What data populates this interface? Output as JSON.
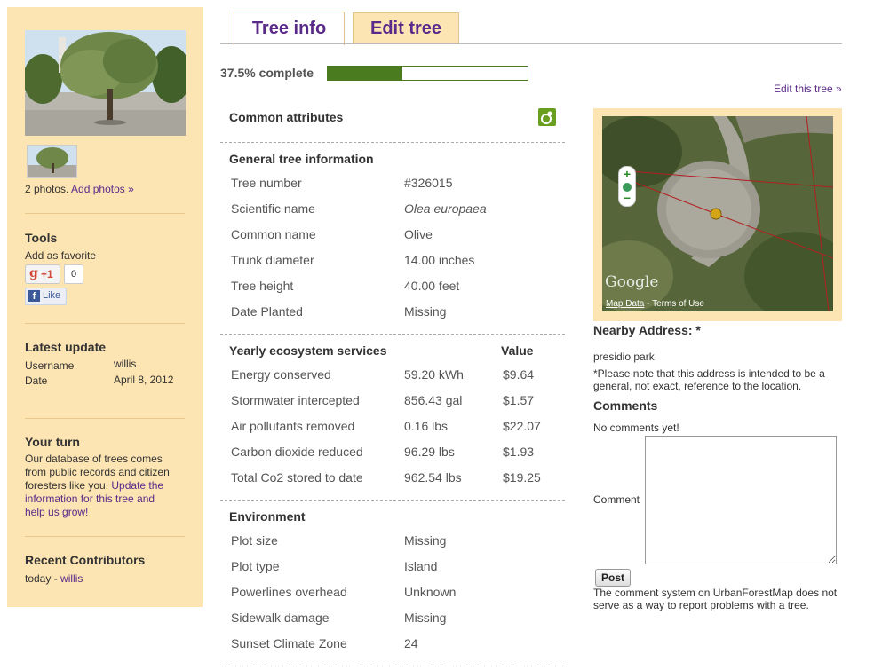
{
  "sidebar": {
    "photos_count": "2 photos.",
    "add_photos": "Add photos »",
    "tools_heading": "Tools",
    "add_favorite": "Add as favorite",
    "gplus_label": "+1",
    "gplus_count": "0",
    "fb_like": "Like",
    "latest_update_heading": "Latest update",
    "username_label": "Username",
    "username_value": "willis",
    "date_label": "Date",
    "date_value": "April 8, 2012",
    "your_turn_heading": "Your turn",
    "your_turn_text_1": "Our database of trees comes",
    "your_turn_text_2": "from public records and citizen",
    "your_turn_text_3": "foresters like you.",
    "your_turn_link_1": "Update the",
    "your_turn_link_2": "information for this tree and",
    "your_turn_link_3": "help us grow!",
    "recent_heading": "Recent Contributors",
    "recent_prefix": "today -",
    "recent_user": "willis"
  },
  "tabs": {
    "info": "Tree info",
    "edit": "Edit tree"
  },
  "progress": {
    "label": "37.5% complete",
    "fraction": 0.375,
    "color": "#4a7b1e"
  },
  "edit_link": "Edit this tree »",
  "attributes": {
    "heading": "Common attributes",
    "general": {
      "heading": "General tree information",
      "rows": [
        {
          "label": "Tree number",
          "value": "#326015"
        },
        {
          "label": "Scientific name",
          "value": "Olea europaea"
        },
        {
          "label": "Common name",
          "value": "Olive"
        },
        {
          "label": "Trunk diameter",
          "value": "14.00 inches"
        },
        {
          "label": "Tree height",
          "value": "40.00 feet"
        },
        {
          "label": "Date Planted",
          "value": "Missing"
        }
      ]
    },
    "eco": {
      "heading": "Yearly ecosystem services",
      "value_heading": "Value",
      "rows": [
        {
          "label": "Energy conserved",
          "amount": "59.20 kWh",
          "value": "$9.64"
        },
        {
          "label": "Stormwater intercepted",
          "amount": "856.43 gal",
          "value": "$1.57"
        },
        {
          "label": "Air pollutants removed",
          "amount": "0.16 lbs",
          "value": "$22.07"
        },
        {
          "label": "Carbon dioxide reduced",
          "amount": "96.29 lbs",
          "value": "$1.93"
        },
        {
          "label": "Total Co2 stored to date",
          "amount": "962.54 lbs",
          "value": "$19.25"
        }
      ]
    },
    "environment": {
      "heading": "Environment",
      "rows": [
        {
          "label": "Plot size",
          "value": "Missing"
        },
        {
          "label": "Plot type",
          "value": "Island"
        },
        {
          "label": "Powerlines overhead",
          "value": "Unknown"
        },
        {
          "label": "Sidewalk damage",
          "value": "Missing"
        },
        {
          "label": "Sunset Climate Zone",
          "value": "24"
        }
      ]
    }
  },
  "map": {
    "zoom_in": "+",
    "zoom_out": "−",
    "google_logo": "Google",
    "map_data": "Map Data",
    "terms": " - Terms of Use"
  },
  "address": {
    "heading": "Nearby Address: *",
    "value": "presidio park",
    "note_1": "*Please note that this address is intended to be a",
    "note_2": "general, not exact, reference to the location."
  },
  "comments": {
    "heading": "Comments",
    "none": "No comments yet!",
    "comment_label": "Comment",
    "comment_value": "",
    "post_button": "Post",
    "disclaimer_1": "The comment system on UrbanForestMap does not",
    "disclaimer_2": "serve as a way to report problems with a tree."
  }
}
